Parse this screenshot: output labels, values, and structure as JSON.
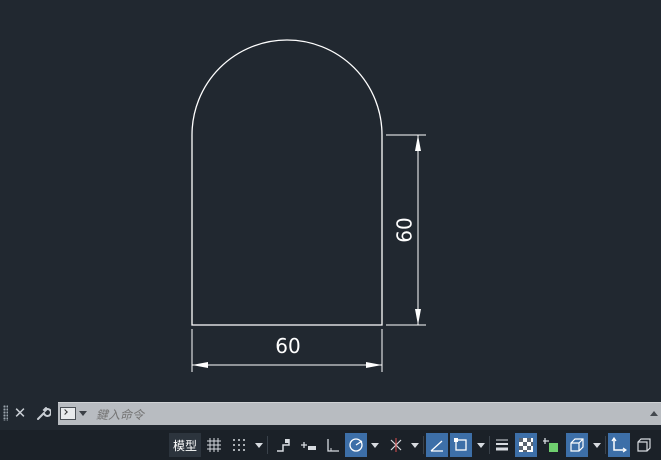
{
  "drawing": {
    "dimension_vertical": "60",
    "dimension_horizontal": "60"
  },
  "command_line": {
    "placeholder": "鍵入命令",
    "close_icon": "close-icon",
    "customize_icon": "wrench-icon"
  },
  "status_bar": {
    "model_label": "模型",
    "items": [
      {
        "name": "grid-display",
        "icon": "grid-icon",
        "active": false
      },
      {
        "name": "snap-mode",
        "icon": "snap-grid-icon",
        "active": false
      },
      {
        "name": "infer-constraints",
        "icon": "infer-constraints-icon",
        "active": false
      },
      {
        "name": "dynamic-input",
        "icon": "dynamic-input-icon",
        "active": false
      },
      {
        "name": "ortho-mode",
        "icon": "ortho-icon",
        "active": false
      },
      {
        "name": "polar-tracking",
        "icon": "polar-tracking-icon",
        "active": true
      },
      {
        "name": "isometric-drafting",
        "icon": "isometric-icon",
        "active": false
      },
      {
        "name": "object-snap-tracking",
        "icon": "snap-tracking-icon",
        "active": true
      },
      {
        "name": "object-snap",
        "icon": "object-snap-icon",
        "active": true
      },
      {
        "name": "lineweight",
        "icon": "lineweight-icon",
        "active": false
      },
      {
        "name": "transparency",
        "icon": "transparency-icon",
        "active": true
      },
      {
        "name": "selection-cycling",
        "icon": "selection-cycling-icon",
        "active": false
      },
      {
        "name": "3d-object-snap",
        "icon": "3d-snap-icon",
        "active": true
      },
      {
        "name": "dynamic-ucs",
        "icon": "dynamic-ucs-icon",
        "active": true
      },
      {
        "name": "selection-filter",
        "icon": "selection-filter-icon",
        "active": false
      }
    ]
  },
  "colors": {
    "background": "#212830",
    "geometry": "#ffffff",
    "active_toggle": "#3d6fa8",
    "command_field": "#b8bcc1"
  }
}
